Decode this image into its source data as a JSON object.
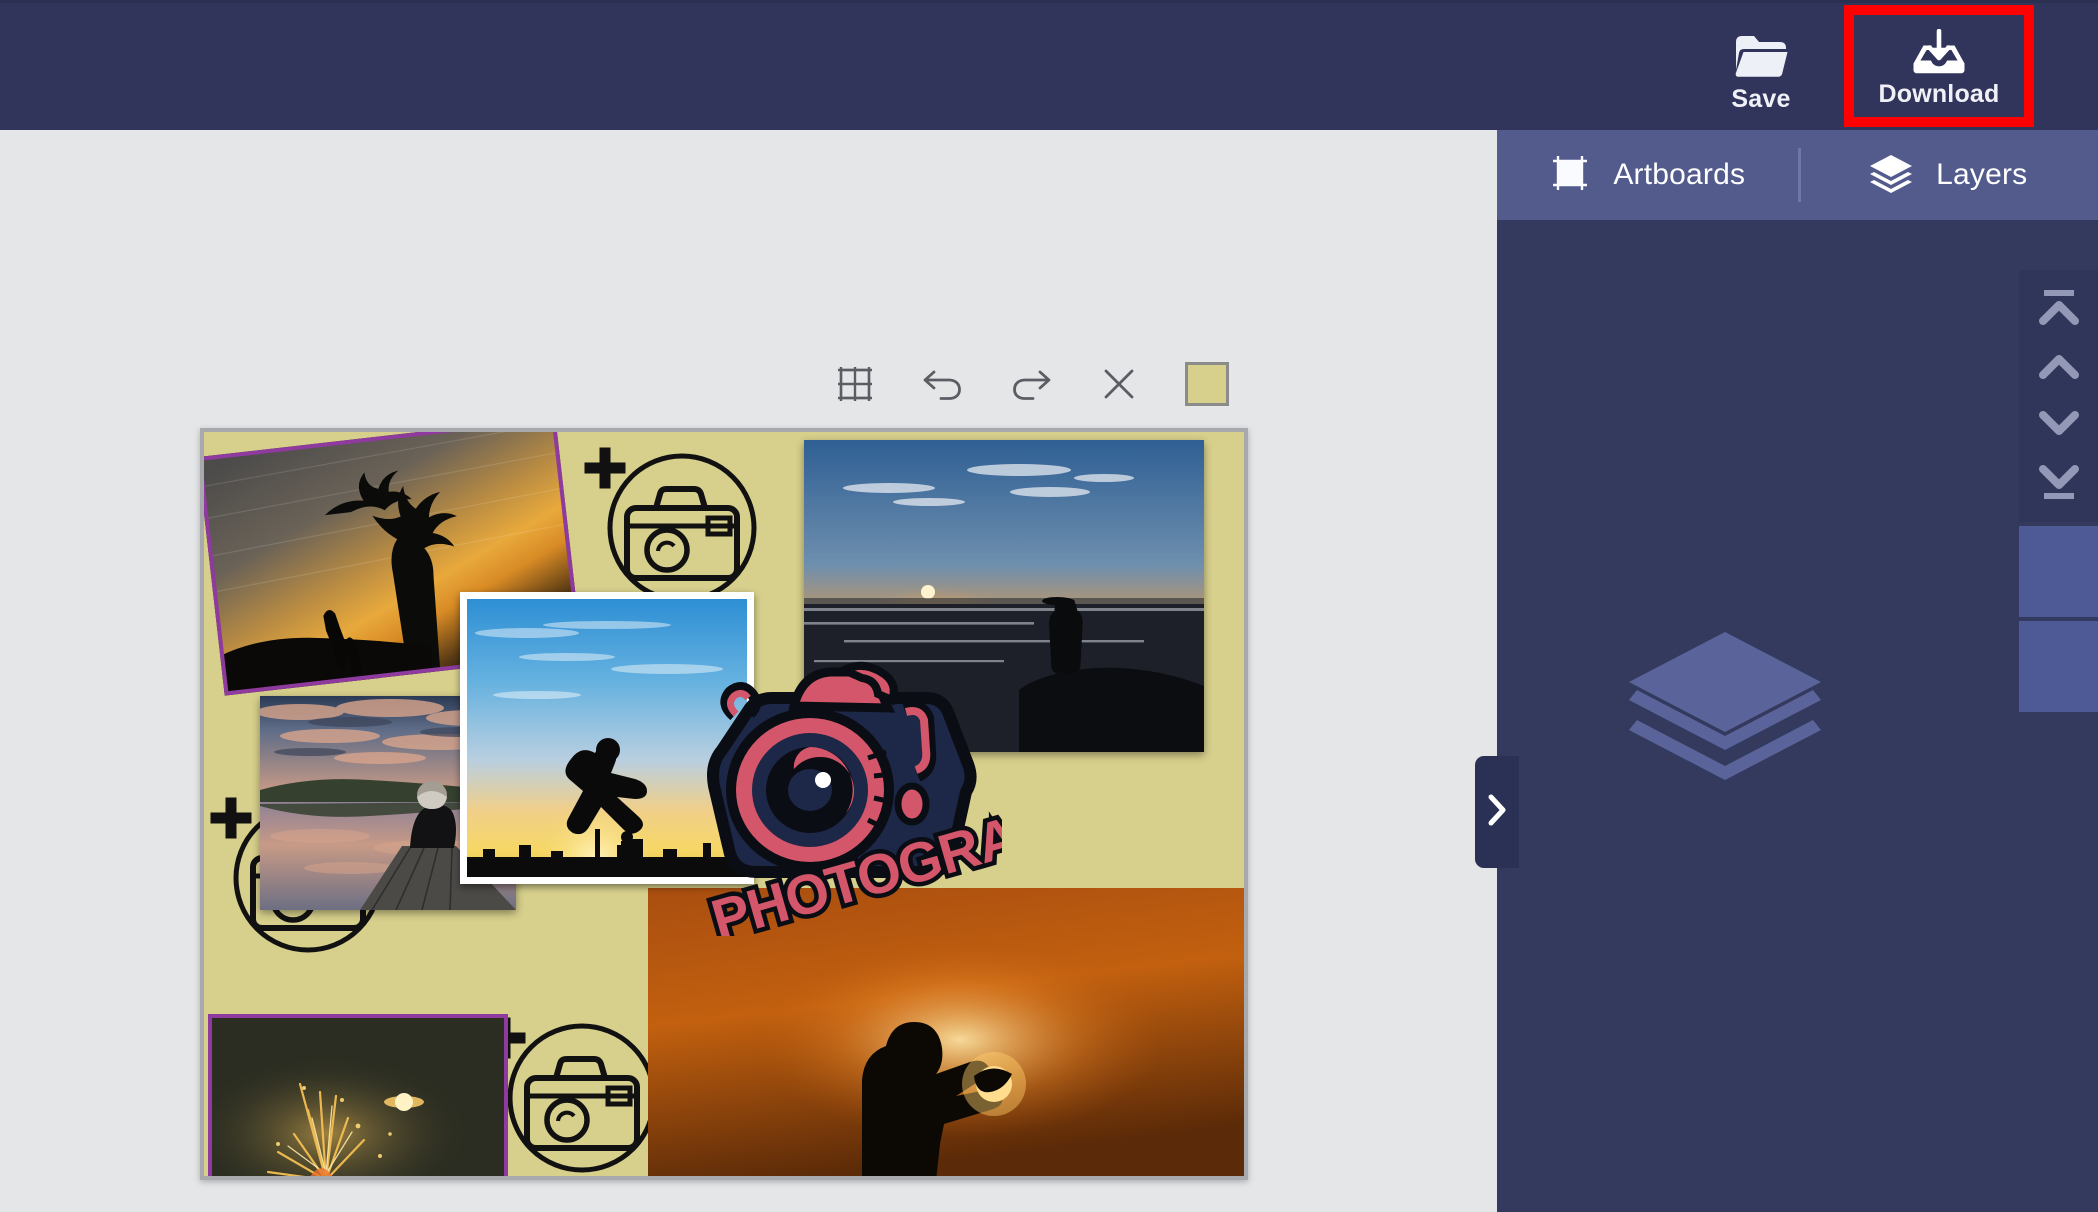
{
  "header": {
    "buttons": [
      {
        "label": "Save",
        "icon": "folder-icon"
      },
      {
        "label": "Download",
        "icon": "download-icon"
      }
    ],
    "save_label": "Save",
    "download_label": "Download",
    "highlight_color": "#ff0000",
    "bg_color": "#31355c"
  },
  "editor_toolbar": {
    "items": [
      {
        "name": "grid-layout-icon",
        "tooltip": "Layout"
      },
      {
        "name": "undo-icon",
        "tooltip": "Undo"
      },
      {
        "name": "redo-icon",
        "tooltip": "Redo"
      },
      {
        "name": "close-icon",
        "tooltip": "Close"
      }
    ],
    "background_swatch": "#d7d08c"
  },
  "artboard": {
    "background_color": "#d7d08c",
    "selection_color": "#8e3a9e",
    "photos": [
      {
        "name": "tree-sunset-silhouette",
        "selected": true,
        "rotated": true
      },
      {
        "name": "beach-sunset-person-on-rock",
        "selected": false
      },
      {
        "name": "lake-dock-person-sitting",
        "selected": false
      },
      {
        "name": "jumping-man-city-skyline",
        "selected": false
      },
      {
        "name": "sunset-hands-holding-sun",
        "selected": false
      },
      {
        "name": "sparks-fire-night",
        "selected": true
      }
    ],
    "sticker": {
      "name": "photography-camera-sticker",
      "text": "PHOTOGRAPHY"
    },
    "placeholders": [
      {
        "name": "add-photo-placeholder-top"
      },
      {
        "name": "add-photo-placeholder-left"
      },
      {
        "name": "add-photo-placeholder-bottom"
      }
    ]
  },
  "right_panel": {
    "tabs": [
      {
        "label": "Artboards",
        "icon": "artboard-icon",
        "active": false
      },
      {
        "label": "Layers",
        "icon": "layers-icon",
        "active": true
      }
    ],
    "artboards_label": "Artboards",
    "layers_label": "Layers",
    "empty_watermark": "layers-icon",
    "bg_color": "#333a5e",
    "tab_bg_color": "#525b8c",
    "order_controls": [
      {
        "name": "move-to-front-button"
      },
      {
        "name": "move-up-button"
      },
      {
        "name": "move-down-button"
      },
      {
        "name": "move-to-back-button"
      }
    ],
    "rail_blocks": [
      {
        "name": "layer-thumb-block"
      },
      {
        "name": "layer-thumb-block"
      }
    ],
    "block_color": "#4e5a96"
  },
  "panel_toggle": {
    "name": "panel-collapse-toggle",
    "icon": "chevron-right-icon"
  }
}
